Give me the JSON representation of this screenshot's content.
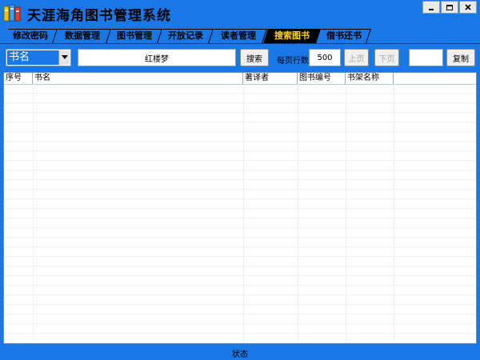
{
  "app": {
    "title": "天涯海角图书管理系统"
  },
  "window_controls": {
    "minimize": "minimize-icon",
    "restore": "restore-icon",
    "close": "close-icon"
  },
  "tabs": [
    {
      "label": "修改密码",
      "active": false
    },
    {
      "label": "数据管理",
      "active": false
    },
    {
      "label": "图书管理",
      "active": false
    },
    {
      "label": "开放记录",
      "active": false
    },
    {
      "label": "读者管理",
      "active": false
    },
    {
      "label": "搜索图书",
      "active": true
    },
    {
      "label": "借书还书",
      "active": false
    }
  ],
  "toolbar": {
    "search_field_selected": "书名",
    "search_value": "红楼梦",
    "search_button": "搜索",
    "rows_per_page_label": "每页行数",
    "rows_per_page_value": "500",
    "prev_page_button": "上页",
    "next_page_button": "下页",
    "copy_input_value": "",
    "copy_button": "复制"
  },
  "table": {
    "columns": [
      "序号",
      "书名",
      "著译者",
      "图书编号",
      "书架名称"
    ],
    "rows": []
  },
  "status": {
    "text": "状态"
  },
  "colors": {
    "background": "#1a78e6",
    "active_tab_bg": "#000000",
    "active_tab_text": "#ffd800"
  }
}
